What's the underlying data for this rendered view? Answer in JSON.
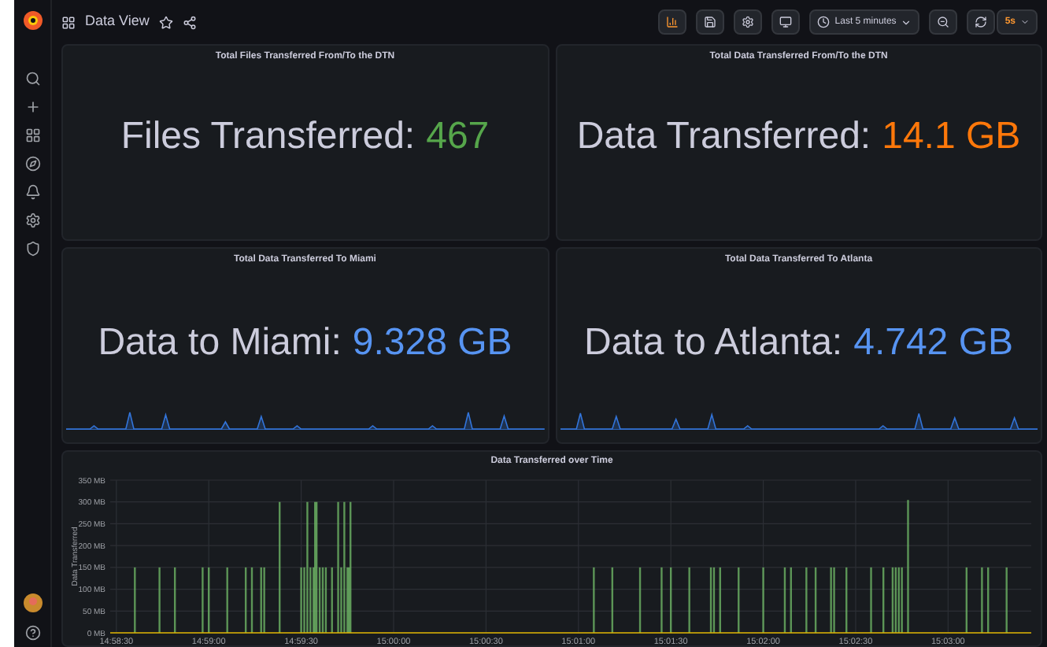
{
  "header": {
    "title": "Data View",
    "time_range": "Last 5 minutes",
    "refresh_interval": "5s"
  },
  "stat_panels": [
    {
      "title": "Total Files Transferred From/To the DTN",
      "label": "Files Transferred:",
      "value": "467",
      "color": "#56a64b",
      "kind": "plain"
    },
    {
      "title": "Total Data Transferred From/To the DTN",
      "label": "Data Transferred:",
      "value": "14.1 GB",
      "color": "#ff780a",
      "kind": "plain"
    },
    {
      "title": "Total Data Transferred To Miami",
      "label": "Data to Miami:",
      "value": "9.328 GB",
      "color": "#5794f2",
      "kind": "sparkline"
    },
    {
      "title": "Total Data Transferred To Atlanta",
      "label": "Data to Atlanta:",
      "value": "4.742 GB",
      "color": "#5794f2",
      "kind": "sparkline"
    }
  ],
  "time_panel": {
    "title": "Data Transferred over Time",
    "y_axis_title": "Data Transferred",
    "y_ticks": [
      "350 MB",
      "300 MB",
      "250 MB",
      "200 MB",
      "150 MB",
      "100 MB",
      "50 MB",
      "0 MB"
    ],
    "x_ticks": [
      "14:58:30",
      "14:59:00",
      "14:59:30",
      "15:00:00",
      "15:00:30",
      "15:01:00",
      "15:01:30",
      "15:02:00",
      "15:02:30",
      "15:03:00"
    ]
  }
}
